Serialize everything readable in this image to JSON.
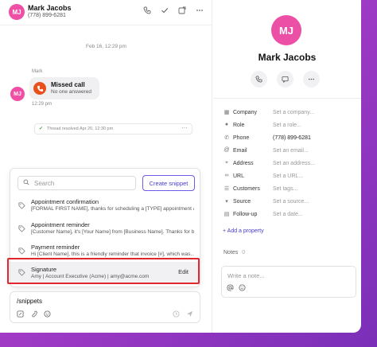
{
  "header": {
    "avatar_initials": "MJ",
    "name": "Mark Jacobs",
    "phone": "(778) 899-6281",
    "icons": [
      "phone-icon",
      "checkmark-icon",
      "open-external-icon",
      "more-icon"
    ]
  },
  "conversation": {
    "date_divider": "Feb 16, 12:29 pm",
    "sender": "Mark",
    "avatar_initials": "MJ",
    "call": {
      "title": "Missed call",
      "subtitle": "No one answered"
    },
    "message_time": "12:29 pm",
    "thread_note": "Thread resolved Apr 20, 12:30 pm"
  },
  "snippets": {
    "search_placeholder": "Search",
    "create_label": "Create snippet",
    "items": [
      {
        "title": "Appointment confirmation",
        "desc": "[FORMAL FIRST NAME], thanks for scheduling a [TYPE] appointment a..."
      },
      {
        "title": "Appointment reminder",
        "desc": "[Customer Name], it's [Your Name] from [Business Name]. Thanks for bo..."
      },
      {
        "title": "Payment reminder",
        "desc": "Hi [Client Name], this is a friendly reminder that invoice [#], which was..."
      },
      {
        "title": "Signature",
        "desc": "Amy | Account Executive (Acme) | amy@acme.com",
        "action": "Edit"
      }
    ]
  },
  "composer": {
    "text": "/snippets"
  },
  "contact": {
    "avatar_initials": "MJ",
    "name": "Mark Jacobs",
    "properties": [
      {
        "icon": "building-icon",
        "label": "Company",
        "value": "Set a company...",
        "filled": false
      },
      {
        "icon": "person-icon",
        "label": "Role",
        "value": "Set a role...",
        "filled": false
      },
      {
        "icon": "phone-icon",
        "label": "Phone",
        "value": "(778) 899-6281",
        "filled": true
      },
      {
        "icon": "at-icon",
        "label": "Email",
        "value": "Set an email...",
        "filled": false
      },
      {
        "icon": "location-icon",
        "label": "Address",
        "value": "Set an address...",
        "filled": false
      },
      {
        "icon": "link-icon",
        "label": "URL",
        "value": "Set a URL...",
        "filled": false
      },
      {
        "icon": "list-icon",
        "label": "Customers",
        "value": "Set tags...",
        "filled": false
      },
      {
        "icon": "dropdown-icon",
        "label": "Source",
        "value": "Set a source...",
        "filled": false
      },
      {
        "icon": "calendar-icon",
        "label": "Follow-up",
        "value": "Set a date...",
        "filled": false
      }
    ],
    "add_property": "+ Add a property",
    "notes_label": "Notes",
    "notes_count": "0",
    "note_placeholder": "Write a note..."
  }
}
